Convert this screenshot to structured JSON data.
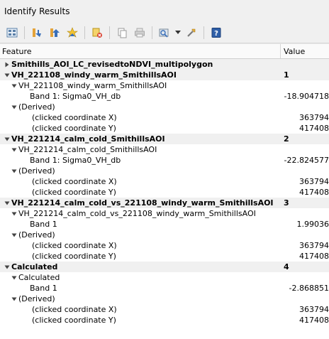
{
  "window": {
    "title": "Identify Results"
  },
  "toolbar": {
    "buttons": [
      {
        "icon": "view-icon"
      },
      {
        "icon": "expand-tree-icon"
      },
      {
        "icon": "collapse-tree-icon"
      },
      {
        "icon": "expand-new-results-icon"
      },
      {
        "icon": "clear-results-icon"
      },
      {
        "icon": "copy-feature-icon"
      },
      {
        "icon": "print-icon"
      },
      {
        "icon": "identify-selection-icon"
      },
      {
        "icon": "settings-icon"
      },
      {
        "icon": "help-icon"
      }
    ]
  },
  "table": {
    "headers": {
      "feature": "Feature",
      "value": "Value"
    },
    "rows": [
      {
        "level": 0,
        "arrow": "right",
        "bold": true,
        "label": "Smithills_AOI_LC_revisedtoNDVI_multipolygon",
        "value": ""
      },
      {
        "level": 0,
        "arrow": "down",
        "bold": true,
        "label": "VH_221108_windy_warm_SmithillsAOI",
        "value": "1"
      },
      {
        "level": 1,
        "arrow": "down",
        "bold": false,
        "label": "VH_221108_windy_warm_SmithillsAOI",
        "value": ""
      },
      {
        "level": 2,
        "arrow": "",
        "bold": false,
        "label": "Band 1: Sigma0_VH_db",
        "value": "-18.904718"
      },
      {
        "level": 1,
        "arrow": "down",
        "bold": false,
        "label": "(Derived)",
        "value": ""
      },
      {
        "level": 3,
        "arrow": "",
        "bold": false,
        "label": "(clicked coordinate X)",
        "value": "363794"
      },
      {
        "level": 3,
        "arrow": "",
        "bold": false,
        "label": "(clicked coordinate Y)",
        "value": "417408"
      },
      {
        "level": 0,
        "arrow": "down",
        "bold": true,
        "label": "VH_221214_calm_cold_SmithillsAOI",
        "value": "2"
      },
      {
        "level": 1,
        "arrow": "down",
        "bold": false,
        "label": "VH_221214_calm_cold_SmithillsAOI",
        "value": ""
      },
      {
        "level": 2,
        "arrow": "",
        "bold": false,
        "label": "Band 1: Sigma0_VH_db",
        "value": "-22.824577"
      },
      {
        "level": 1,
        "arrow": "down",
        "bold": false,
        "label": "(Derived)",
        "value": ""
      },
      {
        "level": 3,
        "arrow": "",
        "bold": false,
        "label": "(clicked coordinate X)",
        "value": "363794"
      },
      {
        "level": 3,
        "arrow": "",
        "bold": false,
        "label": "(clicked coordinate Y)",
        "value": "417408"
      },
      {
        "level": 0,
        "arrow": "down",
        "bold": true,
        "label": "VH_221214_calm_cold_vs_221108_windy_warm_SmithillsAOI",
        "value": "3"
      },
      {
        "level": 1,
        "arrow": "down",
        "bold": false,
        "label": "VH_221214_calm_cold_vs_221108_windy_warm_SmithillsAOI",
        "value": ""
      },
      {
        "level": 2,
        "arrow": "",
        "bold": false,
        "label": "Band 1",
        "value": "1.99036"
      },
      {
        "level": 1,
        "arrow": "down",
        "bold": false,
        "label": "(Derived)",
        "value": ""
      },
      {
        "level": 3,
        "arrow": "",
        "bold": false,
        "label": "(clicked coordinate X)",
        "value": "363794"
      },
      {
        "level": 3,
        "arrow": "",
        "bold": false,
        "label": "(clicked coordinate Y)",
        "value": "417408"
      },
      {
        "level": 0,
        "arrow": "down",
        "bold": true,
        "label": "Calculated",
        "value": "4"
      },
      {
        "level": 1,
        "arrow": "down",
        "bold": false,
        "label": "Calculated",
        "value": ""
      },
      {
        "level": 2,
        "arrow": "",
        "bold": false,
        "label": "Band 1",
        "value": "-2.868851"
      },
      {
        "level": 1,
        "arrow": "down",
        "bold": false,
        "label": "(Derived)",
        "value": ""
      },
      {
        "level": 3,
        "arrow": "",
        "bold": false,
        "label": "(clicked coordinate X)",
        "value": "363794"
      },
      {
        "level": 3,
        "arrow": "",
        "bold": false,
        "label": "(clicked coordinate Y)",
        "value": "417408"
      }
    ]
  }
}
